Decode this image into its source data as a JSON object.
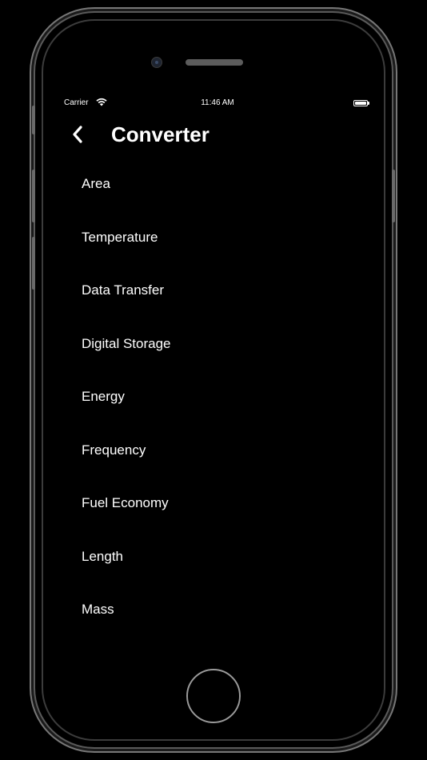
{
  "status_bar": {
    "carrier": "Carrier",
    "time": "11:46 AM",
    "wifi_icon": "wifi-icon",
    "battery_icon": "battery-full-icon"
  },
  "nav": {
    "back_icon": "chevron-left-icon",
    "title": "Converter"
  },
  "categories": [
    "Area",
    "Temperature",
    "Data Transfer",
    "Digital Storage",
    "Energy",
    "Frequency",
    "Fuel Economy",
    "Length",
    "Mass"
  ],
  "colors": {
    "background": "#000000",
    "text": "#ffffff",
    "device_frame": "#777777"
  }
}
